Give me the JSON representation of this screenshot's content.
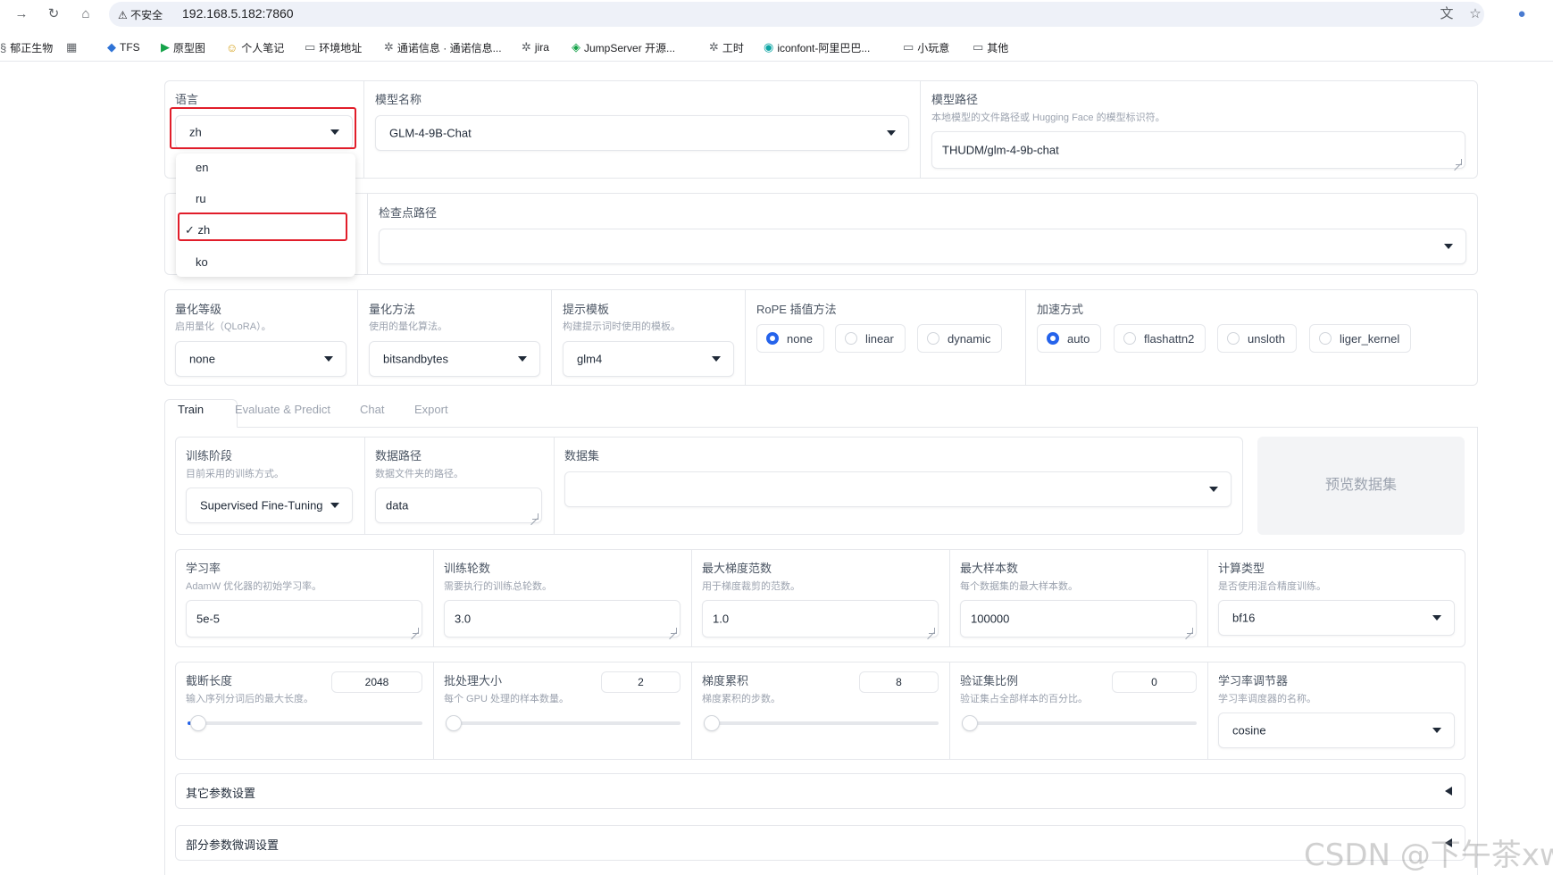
{
  "browser": {
    "insecure_label": "不安全",
    "url": "192.168.5.182:7860",
    "bookmarks": [
      "郁正生物",
      "TFS",
      "原型图",
      "个人笔记",
      "环境地址",
      "通诺信息 · 通诺信息...",
      "jira",
      "JumpServer 开源...",
      "工时",
      "iconfont-阿里巴巴...",
      "小玩意",
      "其他"
    ]
  },
  "top": {
    "language": {
      "label": "语言",
      "value": "zh",
      "options": [
        "en",
        "ru",
        "zh",
        "ko"
      ],
      "selected_mark": "✓"
    },
    "model_name": {
      "label": "模型名称",
      "value": "GLM-4-9B-Chat"
    },
    "model_path": {
      "label": "模型路径",
      "info": "本地模型的文件路径或 Hugging Face 的模型标识符。",
      "value": "THUDM/glm-4-9b-chat"
    },
    "checkpoint": {
      "label": "检查点路径"
    }
  },
  "quant": {
    "level": {
      "label": "量化等级",
      "info": "启用量化（QLoRA）。",
      "value": "none"
    },
    "method": {
      "label": "量化方法",
      "info": "使用的量化算法。",
      "value": "bitsandbytes"
    },
    "template": {
      "label": "提示模板",
      "info": "构建提示词时使用的模板。",
      "value": "glm4"
    },
    "rope": {
      "label": "RoPE 插值方法",
      "options": [
        "none",
        "linear",
        "dynamic"
      ],
      "selected": "none"
    },
    "booster": {
      "label": "加速方式",
      "options": [
        "auto",
        "flashattn2",
        "unsloth",
        "liger_kernel"
      ],
      "selected": "auto"
    }
  },
  "tabs": [
    "Train",
    "Evaluate & Predict",
    "Chat",
    "Export"
  ],
  "train": {
    "stage": {
      "label": "训练阶段",
      "info": "目前采用的训练方式。",
      "value": "Supervised Fine-Tuning"
    },
    "data_dir": {
      "label": "数据路径",
      "info": "数据文件夹的路径。",
      "value": "data"
    },
    "dataset": {
      "label": "数据集"
    },
    "preview_button": "预览数据集",
    "lr": {
      "label": "学习率",
      "info": "AdamW 优化器的初始学习率。",
      "value": "5e-5"
    },
    "epochs": {
      "label": "训练轮数",
      "info": "需要执行的训练总轮数。",
      "value": "3.0"
    },
    "max_grad_norm": {
      "label": "最大梯度范数",
      "info": "用于梯度裁剪的范数。",
      "value": "1.0"
    },
    "max_samples": {
      "label": "最大样本数",
      "info": "每个数据集的最大样本数。",
      "value": "100000"
    },
    "compute_type": {
      "label": "计算类型",
      "info": "是否使用混合精度训练。",
      "value": "bf16"
    },
    "cutoff_len": {
      "label": "截断长度",
      "info": "输入序列分词后的最大长度。",
      "value": "2048"
    },
    "batch_size": {
      "label": "批处理大小",
      "info": "每个 GPU 处理的样本数量。",
      "value": "2"
    },
    "grad_accum": {
      "label": "梯度累积",
      "info": "梯度累积的步数。",
      "value": "8"
    },
    "val_size": {
      "label": "验证集比例",
      "info": "验证集占全部样本的百分比。",
      "value": "0"
    },
    "scheduler": {
      "label": "学习率调节器",
      "info": "学习率调度器的名称。",
      "value": "cosine"
    },
    "extra_args": "其它参数设置",
    "freeze_args": "部分参数微调设置"
  },
  "watermark": "CSDN @下午茶xwc",
  "colors": {
    "accent": "#2563eb",
    "highlight": "#e11d2a",
    "border": "#e5e7eb"
  }
}
